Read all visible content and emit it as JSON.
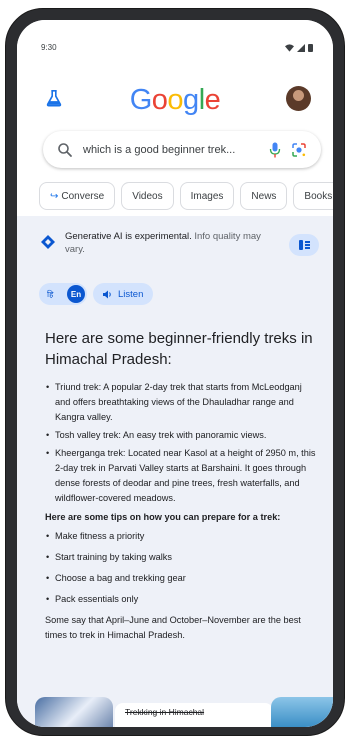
{
  "status_bar": {
    "time": "9:30"
  },
  "header": {
    "logo_letters": [
      {
        "ch": "G",
        "color": "#4285F4"
      },
      {
        "ch": "o",
        "color": "#EA4335"
      },
      {
        "ch": "o",
        "color": "#FBBC05"
      },
      {
        "ch": "g",
        "color": "#4285F4"
      },
      {
        "ch": "l",
        "color": "#34A853"
      },
      {
        "ch": "e",
        "color": "#EA4335"
      }
    ],
    "labs_icon": "flask-icon",
    "avatar_icon": "profile-avatar"
  },
  "search": {
    "query": "which is a good beginner trek...",
    "icons": [
      "search-icon",
      "mic-icon",
      "lens-icon"
    ]
  },
  "chips": [
    {
      "label": "Converse",
      "icon": "follow-up-arrow-icon"
    },
    {
      "label": "Videos"
    },
    {
      "label": "Images"
    },
    {
      "label": "News"
    },
    {
      "label": "Books"
    }
  ],
  "ai_overview": {
    "notice_strong": "Generative AI is experimental.",
    "notice_muted": " Info quality may vary.",
    "lang_alt": "हि",
    "lang_active": "En",
    "listen_label": "Listen",
    "heading": "Here are some beginner-friendly treks in Himachal Pradesh:",
    "treks": [
      "Triund trek: A popular 2-day trek that starts from McLeodganj and offers breathtaking views of the Dhauladhar range and Kangra valley.",
      "Tosh valley trek: An easy trek with panoramic views.",
      "Kheerganga trek: Located near Kasol at a height of 2950 m, this 2-day trek in Parvati Valley starts at Barshaini. It goes through dense forests of deodar and pine trees, fresh waterfalls, and wildflower-covered meadows."
    ],
    "tips_title": "Here are some tips on how you can prepare for a trek:",
    "tips": [
      "Make fitness a priority",
      "Start training by taking walks",
      "Choose a bag and trekking gear",
      "Pack essentials only"
    ],
    "outro": "Some say that April–June and October–November are the best times to trek in Himachal Pradesh.",
    "card_title": "Trekking in Himachal"
  },
  "colors": {
    "accent": "#0b57d0",
    "chip_bg": "#d3e3fd",
    "panel_bg": "#eef1f8"
  }
}
